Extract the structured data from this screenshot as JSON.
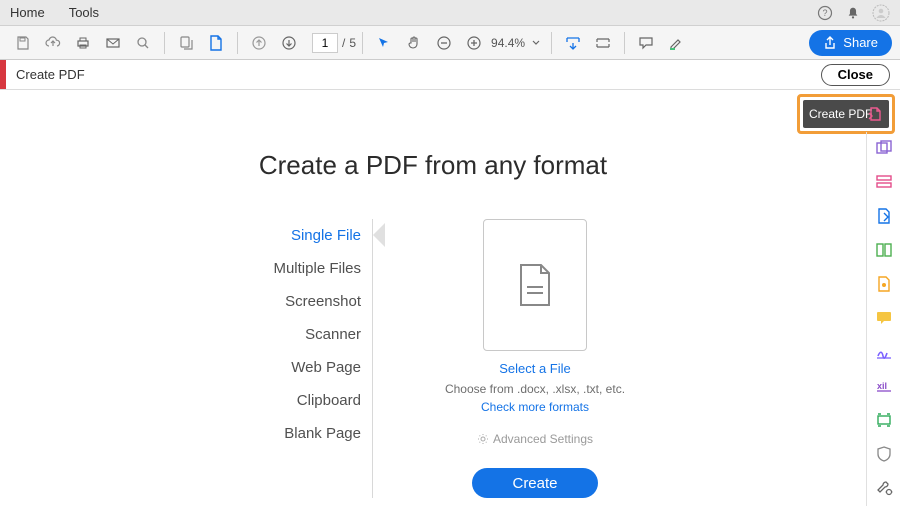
{
  "menubar": {
    "home": "Home",
    "tools": "Tools"
  },
  "toolbar": {
    "page_current": "1",
    "page_sep": "/",
    "page_total": "5",
    "zoom": "94.4%",
    "share": "Share"
  },
  "subheader": {
    "title": "Create PDF",
    "close": "Close"
  },
  "tooltip": {
    "label": "Create PDF"
  },
  "main": {
    "heading": "Create a PDF from any format",
    "sources": [
      "Single File",
      "Multiple Files",
      "Screenshot",
      "Scanner",
      "Web Page",
      "Clipboard",
      "Blank Page"
    ],
    "select_file": "Select a File",
    "hint": "Choose from .docx, .xlsx, .txt, etc.",
    "check_formats": "Check more formats",
    "advanced": "Advanced Settings",
    "create": "Create"
  }
}
